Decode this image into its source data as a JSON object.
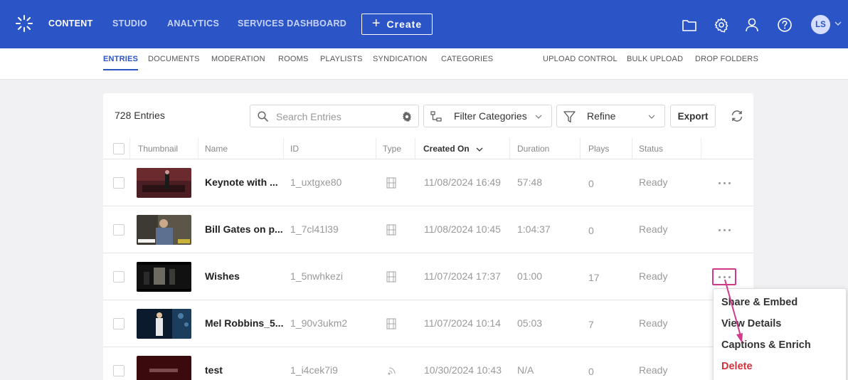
{
  "colors": {
    "brand": "#2b55c7",
    "highlight": "#d13a8a",
    "danger": "#d0323c"
  },
  "topnav": {
    "logo_icon": "kaltura-logo-icon",
    "items": [
      {
        "label": "CONTENT",
        "active": true
      },
      {
        "label": "STUDIO"
      },
      {
        "label": "ANALYTICS"
      },
      {
        "label": "SERVICES DASHBOARD"
      }
    ],
    "create_label": "Create",
    "icons": [
      "folder-icon",
      "gear-icon",
      "user-icon",
      "help-icon"
    ],
    "avatar_initials": "LS"
  },
  "subnav": {
    "items": [
      {
        "label": "ENTRIES",
        "active": true
      },
      {
        "label": "DOCUMENTS"
      },
      {
        "label": "MODERATION"
      },
      {
        "label": "ROOMS"
      },
      {
        "label": "PLAYLISTS"
      },
      {
        "label": "SYNDICATION"
      },
      {
        "label": "CATEGORIES"
      },
      {
        "label": "UPLOAD CONTROL"
      },
      {
        "label": "BULK UPLOAD"
      },
      {
        "label": "DROP FOLDERS"
      }
    ]
  },
  "toolbar": {
    "entries_count": "728 Entries",
    "search_placeholder": "Search Entries",
    "filter_label": "Filter Categories",
    "refine_label": "Refine",
    "export_label": "Export"
  },
  "table": {
    "columns": [
      "Thumbnail",
      "Name",
      "ID",
      "Type",
      "Created On",
      "Duration",
      "Plays",
      "Status"
    ],
    "rows": [
      {
        "name": "Keynote with ...",
        "id": "1_uxtgxe80",
        "type": "video-icon",
        "created": "11/08/2024 16:49",
        "duration": "57:48",
        "plays": "0",
        "status": "Ready"
      },
      {
        "name": "Bill Gates on p...",
        "id": "1_7cl41l39",
        "type": "video-icon",
        "created": "11/08/2024 10:45",
        "duration": "1:04:37",
        "plays": "0",
        "status": "Ready"
      },
      {
        "name": "Wishes",
        "id": "1_5nwhkezi",
        "type": "video-icon",
        "created": "11/07/2024 17:37",
        "duration": "01:00",
        "plays": "17",
        "status": "Ready"
      },
      {
        "name": "Mel Robbins_5...",
        "id": "1_90v3ukm2",
        "type": "video-icon",
        "created": "11/07/2024 10:14",
        "duration": "05:03",
        "plays": "7",
        "status": "Ready"
      },
      {
        "name": "test",
        "id": "1_i4cek7i9",
        "type": "live-stream-icon",
        "created": "10/30/2024 10:43",
        "duration": "N/A",
        "plays": "0",
        "status": "Ready"
      }
    ]
  },
  "context_menu": {
    "items": [
      {
        "label": "Share & Embed"
      },
      {
        "label": "View Details"
      },
      {
        "label": "Captions & Enrich"
      },
      {
        "label": "Delete",
        "danger": true
      }
    ]
  }
}
